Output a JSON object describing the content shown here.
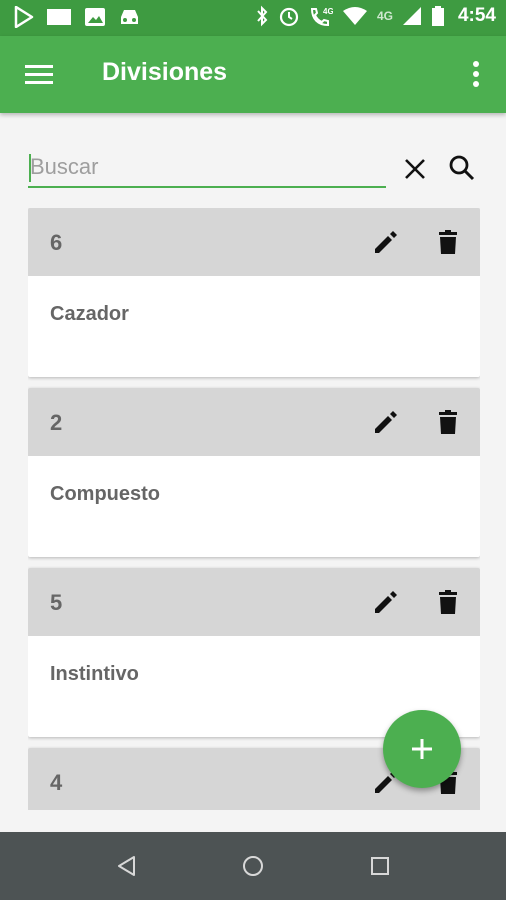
{
  "status_bar": {
    "time": "4:54",
    "network": "4G",
    "icons": [
      "play-store-icon",
      "message-icon",
      "image-icon",
      "car-icon",
      "bluetooth-icon",
      "alarm-icon",
      "call-4g-icon",
      "wifi-icon",
      "signal-icon",
      "battery-icon"
    ]
  },
  "app_bar": {
    "title": "Divisiones",
    "menu_icon": "hamburger-menu-icon",
    "more_icon": "more-vert-icon",
    "background": "#4caf50",
    "status_background": "#3e9b41"
  },
  "search": {
    "placeholder": "Buscar",
    "value": "",
    "clear_icon": "close-icon",
    "search_icon": "search-icon"
  },
  "divisions": [
    {
      "number": "6",
      "name": "Cazador"
    },
    {
      "number": "2",
      "name": "Compuesto"
    },
    {
      "number": "5",
      "name": "Instintivo"
    },
    {
      "number": "4",
      "name": ""
    }
  ],
  "card_actions": {
    "edit_icon": "edit-pencil-icon",
    "delete_icon": "delete-trash-icon"
  },
  "fab": {
    "icon": "add-icon",
    "color": "#4caf50"
  },
  "nav_bar": {
    "icons": [
      "back-icon",
      "home-icon",
      "recents-icon"
    ],
    "background": "#4d5354"
  }
}
